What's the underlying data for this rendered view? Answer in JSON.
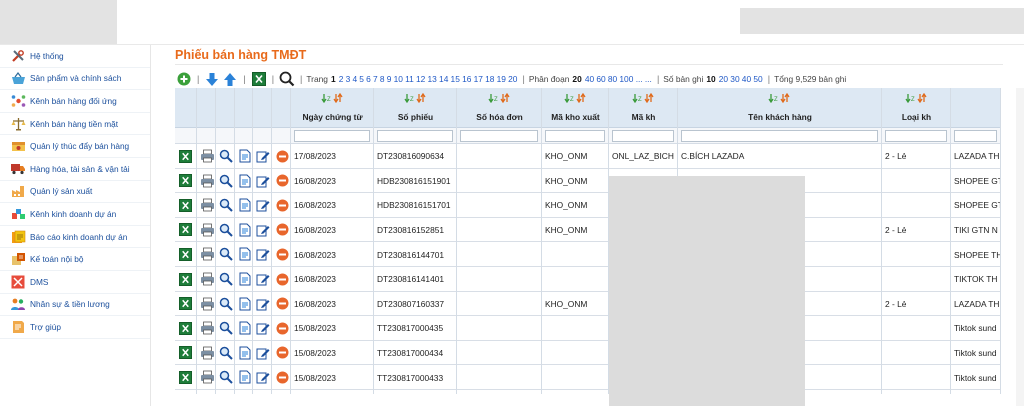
{
  "sidebar": {
    "items": [
      {
        "label": "Hệ thống",
        "icon": "tools-icon"
      },
      {
        "label": "Sản phẩm và chính sách",
        "icon": "basket-icon"
      },
      {
        "label": "Kênh bán hàng đối ứng",
        "icon": "network-icon"
      },
      {
        "label": "Kênh bán hàng tiền mặt",
        "icon": "scale-icon"
      },
      {
        "label": "Quản lý thúc đẩy bán hàng",
        "icon": "promotion-icon"
      },
      {
        "label": "Hàng hóa, tài sản & vận tải",
        "icon": "truck-icon"
      },
      {
        "label": "Quản lý sản xuất",
        "icon": "factory-icon"
      },
      {
        "label": "Kênh kinh doanh dự án",
        "icon": "project-icon"
      },
      {
        "label": "Báo cáo kinh doanh dự án",
        "icon": "report-icon"
      },
      {
        "label": "Kế toán nội bộ",
        "icon": "accounting-icon"
      },
      {
        "label": "DMS",
        "icon": "dms-icon"
      },
      {
        "label": "Nhân sự & tiền lương",
        "icon": "people-icon"
      },
      {
        "label": "Trợ giúp",
        "icon": "help-icon"
      }
    ]
  },
  "page": {
    "title": "Phiếu bán hàng TMĐT"
  },
  "pager": {
    "page_label": "Trang",
    "current_page": "1",
    "pages": [
      "2",
      "3",
      "4",
      "5",
      "6",
      "7",
      "8",
      "9",
      "10",
      "11",
      "12",
      "13",
      "14",
      "15",
      "16",
      "17",
      "18",
      "19",
      "20"
    ],
    "segment_label": "Phân đoạn",
    "current_segment": "20",
    "segments": [
      "40",
      "60",
      "80",
      "100 ...",
      "..."
    ],
    "records_label": "Số bản ghi",
    "current_records": "10",
    "record_options": [
      "20",
      "30",
      "40",
      "50"
    ],
    "total_label": "Tổng 9,529 bản ghi"
  },
  "table": {
    "columns": [
      "Ngày chứng từ",
      "Số phiếu",
      "Số hóa đơn",
      "Mã kho xuất",
      "Mã kh",
      "Tên khách hàng",
      "Loại kh",
      ""
    ],
    "rows": [
      [
        "17/08/2023",
        "DT230816090634",
        "",
        "KHO_ONM",
        "ONL_LAZ_BICH",
        "C.BÍCH LAZADA",
        "2 - Lẻ",
        "LAZADA TH"
      ],
      [
        "16/08/2023",
        "HDB230816151901",
        "",
        "KHO_ONM",
        "",
        "",
        "",
        "SHOPEE GT"
      ],
      [
        "16/08/2023",
        "HDB230816151701",
        "",
        "KHO_ONM",
        "",
        "",
        "",
        "SHOPEE GT"
      ],
      [
        "16/08/2023",
        "DT230816152851",
        "",
        "KHO_ONM",
        "",
        "",
        "2 - Lẻ",
        "TIKI GTN N"
      ],
      [
        "16/08/2023",
        "DT230816144701",
        "",
        "",
        "",
        "",
        "",
        "SHOPEE TH"
      ],
      [
        "16/08/2023",
        "DT230816141401",
        "",
        "",
        "",
        "",
        "",
        "TIKTOK TH"
      ],
      [
        "16/08/2023",
        "DT230807160337",
        "",
        "KHO_ONM",
        "",
        "",
        "2 - Lẻ",
        "LAZADA TH"
      ],
      [
        "15/08/2023",
        "TT230817000435",
        "",
        "",
        "",
        "",
        "",
        "Tiktok sund"
      ],
      [
        "15/08/2023",
        "TT230817000434",
        "",
        "",
        "",
        "",
        "",
        "Tiktok sund"
      ],
      [
        "15/08/2023",
        "TT230817000433",
        "",
        "",
        "",
        "",
        "",
        "Tiktok sund"
      ]
    ]
  },
  "colors": {
    "title": "#e86a1b",
    "link": "#1f58c6",
    "header_bg": "#dde8f3",
    "sidebar_text": "#1b4f9c"
  }
}
